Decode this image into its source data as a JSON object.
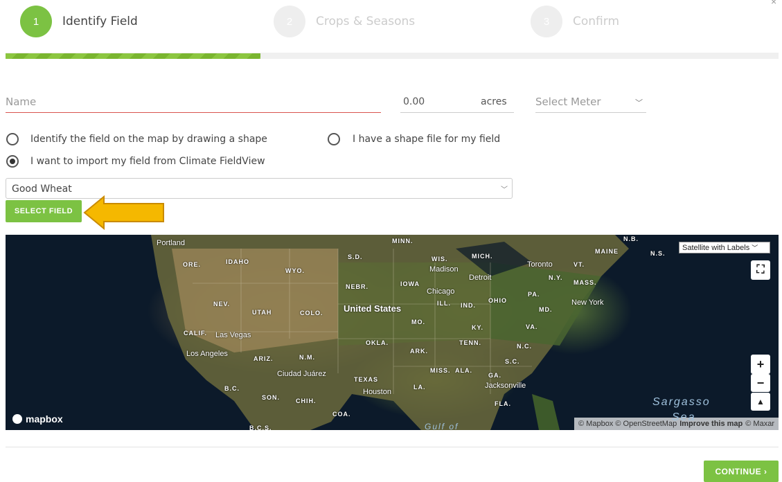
{
  "stepper": {
    "steps": [
      {
        "number": "1",
        "label": "Identify Field",
        "active": true
      },
      {
        "number": "2",
        "label": "Crops & Seasons",
        "active": false
      },
      {
        "number": "3",
        "label": "Confirm",
        "active": false
      }
    ],
    "progress": 0.33
  },
  "form": {
    "name_placeholder": "Name",
    "acres_value": "0.00",
    "acres_unit": "acres",
    "meter_placeholder": "Select Meter",
    "radio_options": [
      {
        "label": "Identify the field on the map by drawing a shape",
        "selected": false
      },
      {
        "label": "I have a shape file for my field",
        "selected": false
      },
      {
        "label": "I want to import my field from Climate FieldView",
        "selected": true
      }
    ],
    "field_select_value": "Good Wheat",
    "select_field_button": "SELECT FIELD"
  },
  "map": {
    "style_select": "Satellite with Labels",
    "logo": "mapbox",
    "attribution": "© Mapbox © OpenStreetMap",
    "improve_link": "Improve this map",
    "attribution_tail": "© Maxar",
    "labels": {
      "portland": "Portland",
      "ore": "ORE.",
      "idaho": "IDAHO",
      "wyo": "WYO.",
      "sd": "S.D.",
      "minn": "MINN.",
      "wis": "WIS.",
      "madison": "Madison",
      "mich": "MICH.",
      "toronto": "Toronto",
      "vt": "VT.",
      "maine": "MAINE",
      "ns": "N.S.",
      "nb": "N.B.",
      "nebr": "NEBR.",
      "iowa": "IOWA",
      "chicago": "Chicago",
      "detroit": "Detroit",
      "ny": "N.Y.",
      "mass": "MASS.",
      "nev": "NEV.",
      "utah": "UTAH",
      "colo": "COLO.",
      "united_states": "United States",
      "ill": "ILL.",
      "ind": "IND.",
      "ohio": "OHIO",
      "pa": "PA.",
      "newyork": "New York",
      "md": "MD.",
      "mo": "MO.",
      "ky": "KY.",
      "va": "VA.",
      "calif": "CALIF.",
      "lasvegas": "Las Vegas",
      "okla": "OKLA.",
      "tenn": "TENN.",
      "ark": "ARK.",
      "nc": "N.C.",
      "losangeles": "Los Angeles",
      "ariz": "ARIZ.",
      "nm": "N.M.",
      "sc": "S.C.",
      "miss": "MISS.",
      "ala": "ALA.",
      "ga": "GA.",
      "ciudadjuarez": "Ciudad Juárez",
      "texas": "TEXAS",
      "bc": "B.C.",
      "houston": "Houston",
      "la": "LA.",
      "jacksonville": "Jacksonville",
      "son": "SON.",
      "chih": "CHIH.",
      "fla": "FLA.",
      "coa": "COA.",
      "bcs": "B.C.S.",
      "gulf": "Gulf of",
      "sargasso": "Sargasso",
      "sea": "Sea"
    }
  },
  "footer": {
    "continue_button": "CONTINUE ›"
  },
  "colors": {
    "accent": "#7cc243",
    "step_inactive": "#eeeeee",
    "error_line": "#d9534f",
    "arrow": "#f5b800"
  }
}
